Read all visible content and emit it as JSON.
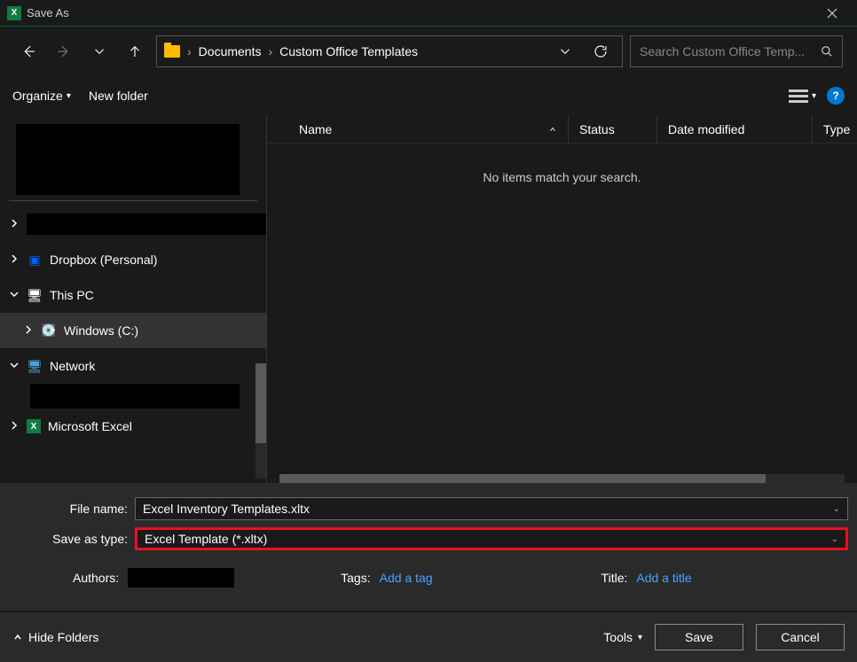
{
  "title": "Save As",
  "breadcrumbs": [
    "Documents",
    "Custom Office Templates"
  ],
  "search": {
    "placeholder": "Search Custom Office Temp..."
  },
  "toolbar": {
    "organize": "Organize",
    "newFolder": "New folder"
  },
  "tree": {
    "dropbox": "Dropbox (Personal)",
    "thisPC": "This PC",
    "windowsC": "Windows (C:)",
    "network": "Network",
    "excel": "Microsoft Excel"
  },
  "columns": {
    "name": "Name",
    "status": "Status",
    "modified": "Date modified",
    "type": "Type"
  },
  "emptyMessage": "No items match your search.",
  "form": {
    "fileNameLabel": "File name:",
    "fileNameValue": "Excel Inventory Templates.xltx",
    "saveTypeLabel": "Save as type:",
    "saveTypeValue": "Excel Template (*.xltx)",
    "authorsLabel": "Authors:",
    "tagsLabel": "Tags:",
    "tagsPlaceholder": "Add a tag",
    "titleLabel": "Title:",
    "titlePlaceholder": "Add a title"
  },
  "actions": {
    "hideFolders": "Hide Folders",
    "tools": "Tools",
    "save": "Save",
    "cancel": "Cancel"
  }
}
